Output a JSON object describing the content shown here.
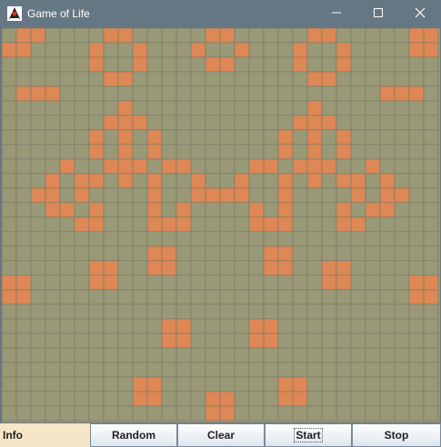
{
  "window": {
    "title": "Game of Life",
    "icon": "duke-mascot-icon"
  },
  "board": {
    "columns": 30,
    "rows": 27,
    "dead_color": "#999977",
    "alive_color": "#dd8855",
    "grid_color": "#777766",
    "live_cells": [
      [
        0,
        1
      ],
      [
        0,
        2
      ],
      [
        0,
        7
      ],
      [
        0,
        8
      ],
      [
        0,
        14
      ],
      [
        0,
        15
      ],
      [
        0,
        21
      ],
      [
        0,
        22
      ],
      [
        0,
        28
      ],
      [
        0,
        29
      ],
      [
        1,
        0
      ],
      [
        1,
        1
      ],
      [
        1,
        6
      ],
      [
        1,
        9
      ],
      [
        1,
        13
      ],
      [
        1,
        16
      ],
      [
        1,
        20
      ],
      [
        1,
        23
      ],
      [
        1,
        28
      ],
      [
        1,
        29
      ],
      [
        2,
        6
      ],
      [
        2,
        9
      ],
      [
        2,
        14
      ],
      [
        2,
        15
      ],
      [
        2,
        20
      ],
      [
        2,
        23
      ],
      [
        3,
        7
      ],
      [
        3,
        8
      ],
      [
        3,
        21
      ],
      [
        3,
        22
      ],
      [
        4,
        1
      ],
      [
        4,
        2
      ],
      [
        4,
        3
      ],
      [
        4,
        26
      ],
      [
        4,
        27
      ],
      [
        4,
        28
      ],
      [
        5,
        8
      ],
      [
        5,
        21
      ],
      [
        6,
        7
      ],
      [
        6,
        8
      ],
      [
        6,
        9
      ],
      [
        6,
        20
      ],
      [
        6,
        21
      ],
      [
        6,
        22
      ],
      [
        7,
        6
      ],
      [
        7,
        8
      ],
      [
        7,
        10
      ],
      [
        7,
        19
      ],
      [
        7,
        21
      ],
      [
        7,
        23
      ],
      [
        8,
        6
      ],
      [
        8,
        8
      ],
      [
        8,
        10
      ],
      [
        8,
        19
      ],
      [
        8,
        21
      ],
      [
        8,
        23
      ],
      [
        9,
        4
      ],
      [
        9,
        7
      ],
      [
        9,
        8
      ],
      [
        9,
        9
      ],
      [
        9,
        11
      ],
      [
        9,
        12
      ],
      [
        9,
        17
      ],
      [
        9,
        18
      ],
      [
        9,
        20
      ],
      [
        9,
        21
      ],
      [
        9,
        22
      ],
      [
        9,
        25
      ],
      [
        10,
        3
      ],
      [
        10,
        5
      ],
      [
        10,
        6
      ],
      [
        10,
        8
      ],
      [
        10,
        10
      ],
      [
        10,
        13
      ],
      [
        10,
        16
      ],
      [
        10,
        19
      ],
      [
        10,
        21
      ],
      [
        10,
        23
      ],
      [
        10,
        24
      ],
      [
        10,
        26
      ],
      [
        11,
        2
      ],
      [
        11,
        3
      ],
      [
        11,
        5
      ],
      [
        11,
        10
      ],
      [
        11,
        13
      ],
      [
        11,
        14
      ],
      [
        11,
        15
      ],
      [
        11,
        16
      ],
      [
        11,
        19
      ],
      [
        11,
        24
      ],
      [
        11,
        26
      ],
      [
        11,
        27
      ],
      [
        12,
        3
      ],
      [
        12,
        4
      ],
      [
        12,
        6
      ],
      [
        12,
        10
      ],
      [
        12,
        12
      ],
      [
        12,
        17
      ],
      [
        12,
        19
      ],
      [
        12,
        23
      ],
      [
        12,
        25
      ],
      [
        12,
        26
      ],
      [
        13,
        5
      ],
      [
        13,
        6
      ],
      [
        13,
        10
      ],
      [
        13,
        11
      ],
      [
        13,
        12
      ],
      [
        13,
        17
      ],
      [
        13,
        18
      ],
      [
        13,
        19
      ],
      [
        13,
        23
      ],
      [
        13,
        24
      ],
      [
        15,
        10
      ],
      [
        15,
        11
      ],
      [
        15,
        18
      ],
      [
        15,
        19
      ],
      [
        16,
        6
      ],
      [
        16,
        7
      ],
      [
        16,
        10
      ],
      [
        16,
        11
      ],
      [
        16,
        18
      ],
      [
        16,
        19
      ],
      [
        16,
        22
      ],
      [
        16,
        23
      ],
      [
        17,
        0
      ],
      [
        17,
        1
      ],
      [
        17,
        6
      ],
      [
        17,
        7
      ],
      [
        17,
        22
      ],
      [
        17,
        23
      ],
      [
        17,
        28
      ],
      [
        17,
        29
      ],
      [
        18,
        0
      ],
      [
        18,
        1
      ],
      [
        18,
        28
      ],
      [
        18,
        29
      ],
      [
        20,
        11
      ],
      [
        20,
        12
      ],
      [
        20,
        17
      ],
      [
        20,
        18
      ],
      [
        21,
        11
      ],
      [
        21,
        12
      ],
      [
        21,
        17
      ],
      [
        21,
        18
      ],
      [
        24,
        9
      ],
      [
        24,
        10
      ],
      [
        24,
        19
      ],
      [
        24,
        20
      ],
      [
        25,
        9
      ],
      [
        25,
        10
      ],
      [
        25,
        14
      ],
      [
        25,
        15
      ],
      [
        25,
        19
      ],
      [
        25,
        20
      ],
      [
        26,
        14
      ],
      [
        26,
        15
      ]
    ]
  },
  "controls": {
    "info_label": "Info",
    "random_label": "Random",
    "clear_label": "Clear",
    "start_label": "Start",
    "stop_label": "Stop"
  }
}
